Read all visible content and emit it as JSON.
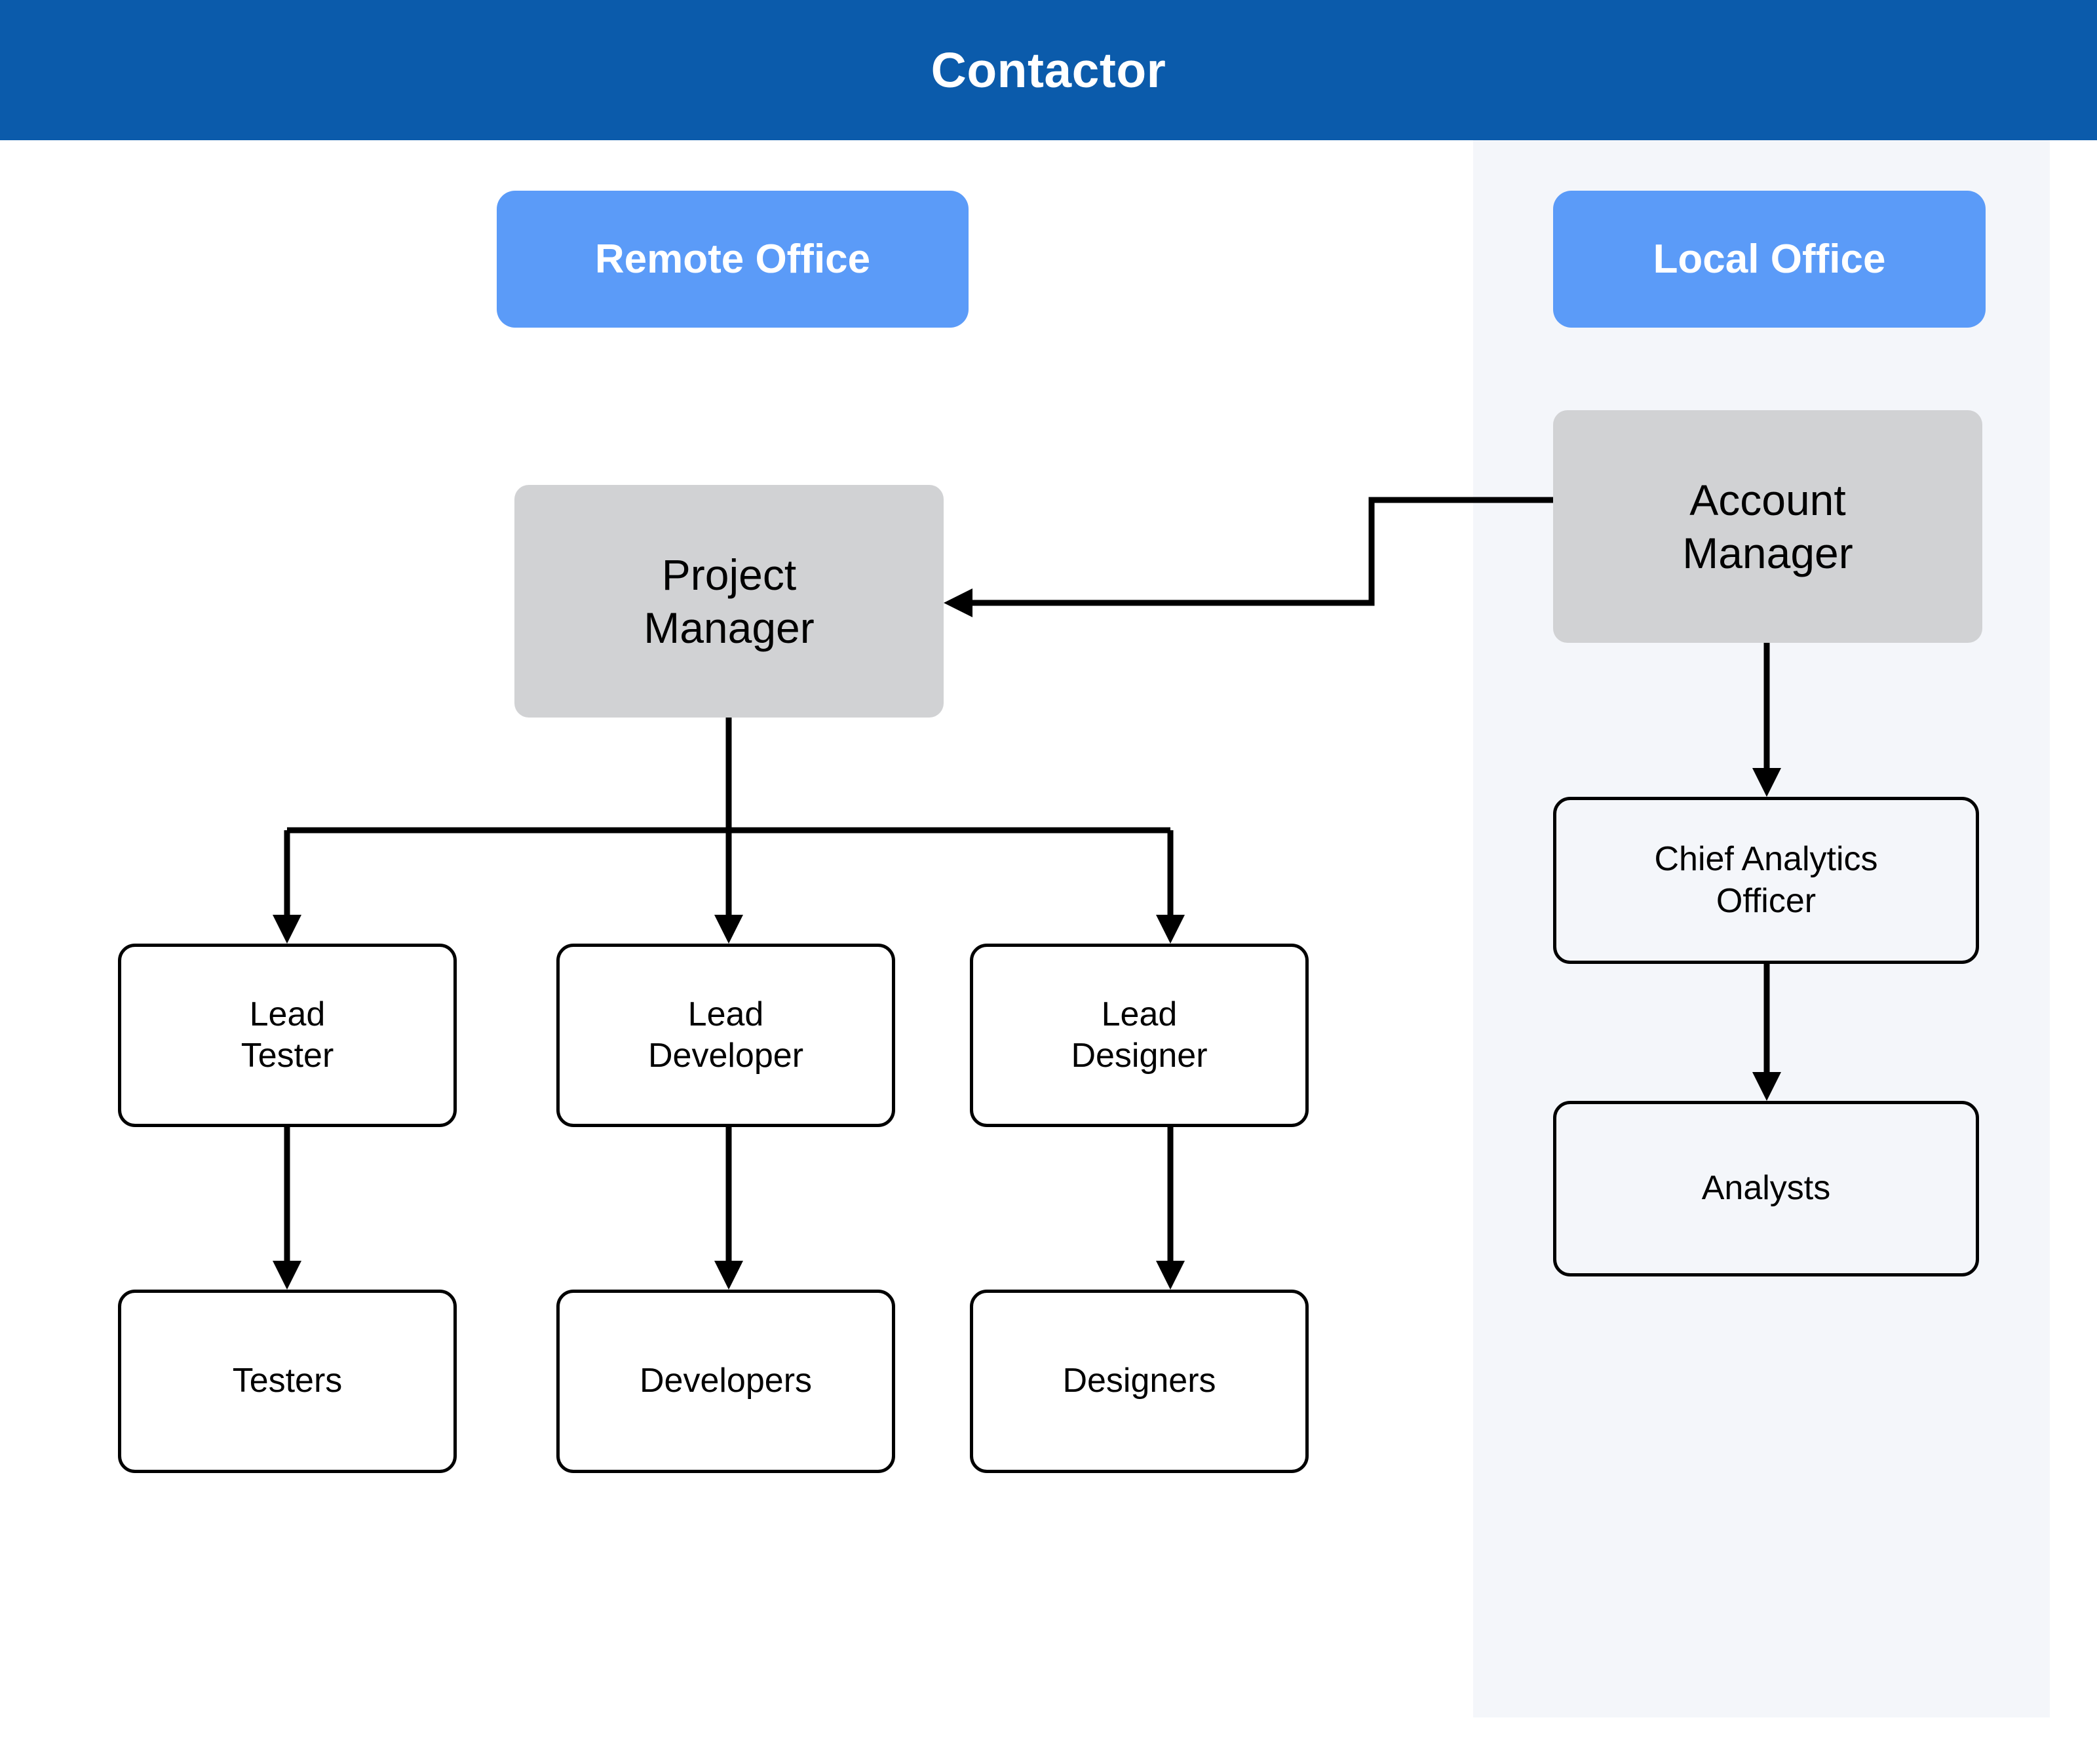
{
  "header": {
    "title": "Contactor",
    "background_color": "#0b5bab",
    "text_color": "#ffffff"
  },
  "panels": {
    "remote_office": {
      "badge_label": "Remote Office",
      "badge_color": "#5b9bf8",
      "background_color": "#ffffff"
    },
    "local_office": {
      "badge_label": "Local Office",
      "badge_color": "#5b9bf8",
      "background_color": "#f4f6fa"
    }
  },
  "chart_data": {
    "type": "diagram",
    "title": "Contactor",
    "groups": [
      {
        "id": "remote-office",
        "label": "Remote Office",
        "nodes": [
          "project-manager",
          "lead-tester",
          "lead-developer",
          "lead-designer",
          "testers",
          "developers",
          "designers"
        ]
      },
      {
        "id": "local-office",
        "label": "Local Office",
        "nodes": [
          "account-manager",
          "chief-analytics-officer",
          "analysts"
        ]
      }
    ],
    "nodes": [
      {
        "id": "project-manager",
        "label": "Project\nManager",
        "style": "filled",
        "fill": "#d1d2d4",
        "group": "remote-office"
      },
      {
        "id": "lead-tester",
        "label": "Lead\nTester",
        "style": "outline",
        "fill": "none",
        "group": "remote-office"
      },
      {
        "id": "lead-developer",
        "label": "Lead\nDeveloper",
        "style": "outline",
        "fill": "none",
        "group": "remote-office"
      },
      {
        "id": "lead-designer",
        "label": "Lead\nDesigner",
        "style": "outline",
        "fill": "none",
        "group": "remote-office"
      },
      {
        "id": "testers",
        "label": "Testers",
        "style": "outline",
        "fill": "none",
        "group": "remote-office"
      },
      {
        "id": "developers",
        "label": "Developers",
        "style": "outline",
        "fill": "none",
        "group": "remote-office"
      },
      {
        "id": "designers",
        "label": "Designers",
        "style": "outline",
        "fill": "none",
        "group": "remote-office"
      },
      {
        "id": "account-manager",
        "label": "Account\nManager",
        "style": "filled",
        "fill": "#d1d2d4",
        "group": "local-office"
      },
      {
        "id": "chief-analytics-officer",
        "label": "Chief Analytics\nOfficer",
        "style": "outline",
        "fill": "none",
        "group": "local-office"
      },
      {
        "id": "analysts",
        "label": "Analysts",
        "style": "outline",
        "fill": "none",
        "group": "local-office"
      }
    ],
    "edges": [
      {
        "from": "account-manager",
        "to": "project-manager",
        "arrow": "to",
        "routing": "orthogonal"
      },
      {
        "from": "account-manager",
        "to": "chief-analytics-officer",
        "arrow": "to",
        "routing": "straight"
      },
      {
        "from": "chief-analytics-officer",
        "to": "analysts",
        "arrow": "to",
        "routing": "straight"
      },
      {
        "from": "project-manager",
        "to": "lead-tester",
        "arrow": "to",
        "routing": "orthogonal"
      },
      {
        "from": "project-manager",
        "to": "lead-developer",
        "arrow": "to",
        "routing": "orthogonal"
      },
      {
        "from": "project-manager",
        "to": "lead-designer",
        "arrow": "to",
        "routing": "orthogonal"
      },
      {
        "from": "lead-tester",
        "to": "testers",
        "arrow": "to",
        "routing": "straight"
      },
      {
        "from": "lead-developer",
        "to": "developers",
        "arrow": "to",
        "routing": "straight"
      },
      {
        "from": "lead-designer",
        "to": "designers",
        "arrow": "to",
        "routing": "straight"
      }
    ],
    "edge_color": "#000000",
    "node_text_color": "#000000",
    "node_border_color": "#000000"
  },
  "nodes": {
    "project_manager": "Project\nManager",
    "lead_tester": "Lead\nTester",
    "lead_developer": "Lead\nDeveloper",
    "lead_designer": "Lead\nDesigner",
    "testers": "Testers",
    "developers": "Developers",
    "designers": "Designers",
    "account_manager": "Account\nManager",
    "chief_analytics_officer": "Chief Analytics\nOfficer",
    "analysts": "Analysts"
  }
}
